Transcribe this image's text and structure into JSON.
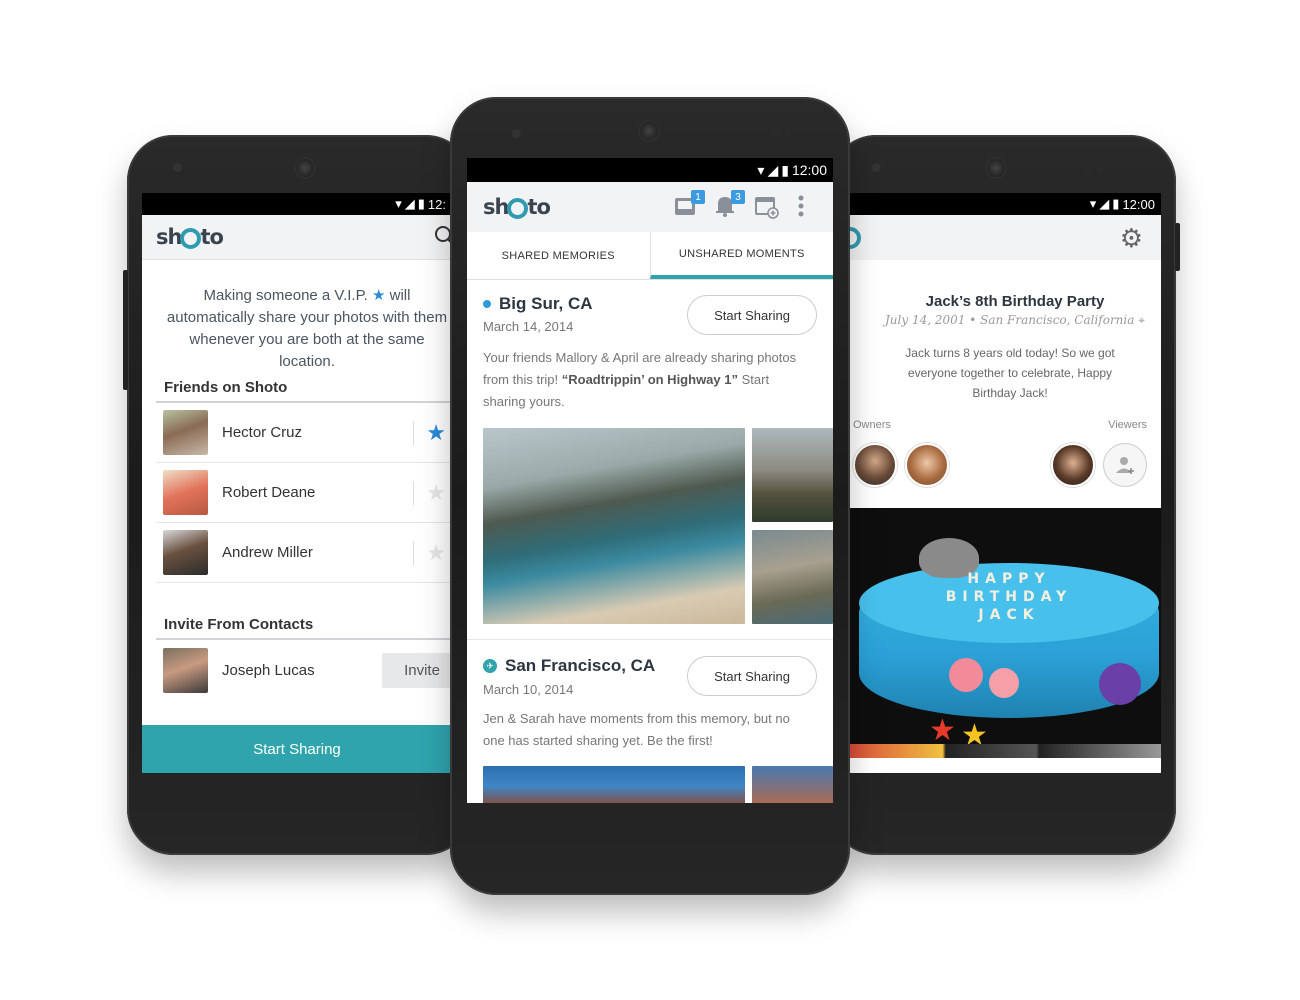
{
  "left_screen": {
    "status_time": "12:",
    "app_name": "shoto",
    "intro_part1": "Making someone a V.I.P.",
    "intro_part2": "will automatically share your photos with them whenever you are both at the same location.",
    "friends_title": "Friends on Shoto",
    "friends": [
      {
        "name": "Hector Cruz",
        "vip": true
      },
      {
        "name": "Robert Deane",
        "vip": false
      },
      {
        "name": "Andrew Miller",
        "vip": false
      }
    ],
    "invite_title": "Invite From Contacts",
    "contacts": [
      {
        "name": "Joseph Lucas",
        "action": "Invite"
      }
    ],
    "bottom_button": "Start Sharing"
  },
  "center_screen": {
    "status_time": "12:00",
    "app_name": "shoto",
    "badges": {
      "inbox": "1",
      "notifications": "3"
    },
    "tabs": [
      {
        "label": "SHARED MEMORIES",
        "active": false
      },
      {
        "label": "UNSHARED MOMENTS",
        "active": true
      }
    ],
    "cards": [
      {
        "title": "Big Sur, CA",
        "date": "March 14, 2014",
        "button": "Start Sharing",
        "desc_before": "Your friends Mallory & April are already sharing photos from this trip!",
        "desc_bold": "“Roadtrippin’ on Highway 1”",
        "desc_after": "Start sharing yours."
      },
      {
        "title": "San Francisco, CA",
        "date": "March 10, 2014",
        "button": "Start Sharing",
        "desc_before": "Jen & Sarah have moments from this memory, but no one has started sharing yet. Be the first!",
        "desc_bold": "",
        "desc_after": ""
      }
    ]
  },
  "right_screen": {
    "status_time": "12:00",
    "event_title": "Jack’s 8th Birthday Party",
    "event_meta": "July 14, 2001 • San Francisco, California",
    "event_desc": "Jack turns 8 years old today! So we got everyone together to celebrate, Happy Birthday Jack!",
    "owners_label": "Owners",
    "viewers_label": "Viewers",
    "cake_text_line1": "HAPPY",
    "cake_text_line2": "BIRTHDAY",
    "cake_text_line3": "JACK"
  },
  "colors": {
    "accent": "#2fa4ad",
    "vip_star": "#2a8ad6",
    "badge": "#3c9be0"
  }
}
